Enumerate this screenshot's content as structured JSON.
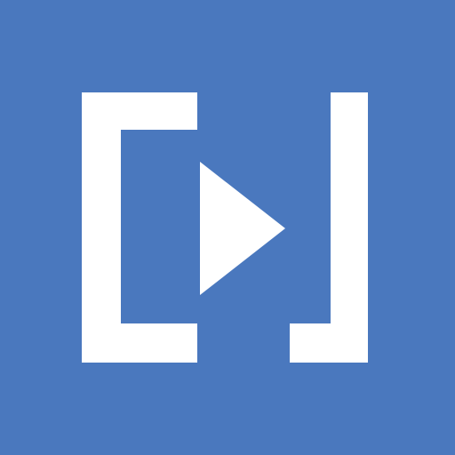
{
  "icon": {
    "name": "play-bracket-logo-icon",
    "colors": {
      "background": "#4A78BE",
      "foreground": "#FFFFFF"
    }
  }
}
